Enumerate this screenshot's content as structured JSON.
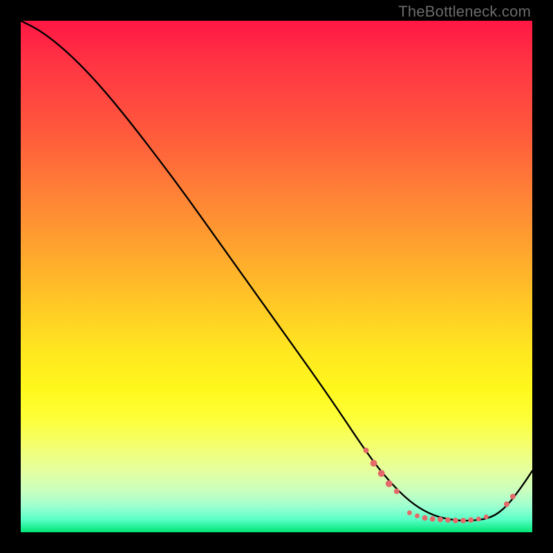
{
  "watermark": "TheBottleneck.com",
  "chart_data": {
    "type": "line",
    "title": "",
    "xlabel": "",
    "ylabel": "",
    "xlim": [
      0,
      100
    ],
    "ylim": [
      0,
      100
    ],
    "series": [
      {
        "name": "curve",
        "x": [
          0,
          4,
          9,
          14,
          20,
          30,
          40,
          50,
          60,
          68,
          72,
          76,
          80,
          84,
          88,
          92,
          95,
          98,
          100
        ],
        "y": [
          100,
          98,
          94,
          89,
          82,
          69,
          55,
          41,
          27,
          15,
          10,
          6,
          3.5,
          2.4,
          2.2,
          2.8,
          5,
          9,
          12
        ]
      }
    ],
    "markers": [
      {
        "x": 67.5,
        "y": 16.0,
        "r": 4
      },
      {
        "x": 69.0,
        "y": 13.5,
        "r": 5
      },
      {
        "x": 70.5,
        "y": 11.5,
        "r": 5
      },
      {
        "x": 72.0,
        "y": 9.5,
        "r": 5
      },
      {
        "x": 73.5,
        "y": 8.0,
        "r": 4
      },
      {
        "x": 76.0,
        "y": 3.8,
        "r": 3.5
      },
      {
        "x": 77.5,
        "y": 3.2,
        "r": 3.5
      },
      {
        "x": 79.0,
        "y": 2.8,
        "r": 4
      },
      {
        "x": 80.5,
        "y": 2.6,
        "r": 4
      },
      {
        "x": 82.0,
        "y": 2.5,
        "r": 4
      },
      {
        "x": 83.5,
        "y": 2.4,
        "r": 4
      },
      {
        "x": 85.0,
        "y": 2.3,
        "r": 4
      },
      {
        "x": 86.5,
        "y": 2.3,
        "r": 4
      },
      {
        "x": 88.0,
        "y": 2.4,
        "r": 4
      },
      {
        "x": 89.5,
        "y": 2.6,
        "r": 3.5
      },
      {
        "x": 91.0,
        "y": 3.0,
        "r": 3.5
      },
      {
        "x": 95.0,
        "y": 5.5,
        "r": 4
      },
      {
        "x": 96.2,
        "y": 7.0,
        "r": 4
      }
    ],
    "marker_color": "#e46a6a",
    "curve_color": "#000000"
  }
}
